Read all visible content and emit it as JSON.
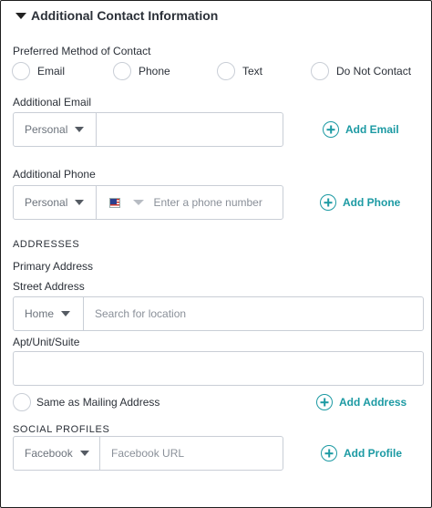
{
  "section": {
    "title": "Additional Contact Information"
  },
  "preferred_contact": {
    "label": "Preferred Method of Contact",
    "options": [
      "Email",
      "Phone",
      "Text",
      "Do Not Contact"
    ]
  },
  "additional_email": {
    "label": "Additional Email",
    "type_value": "Personal",
    "email_value": "",
    "email_placeholder": "",
    "add_label": "Add Email"
  },
  "additional_phone": {
    "label": "Additional Phone",
    "type_value": "Personal",
    "phone_placeholder": "Enter a phone number",
    "add_label": "Add Phone"
  },
  "addresses": {
    "heading": "ADDRESSES",
    "primary_label": "Primary Address",
    "street_label": "Street Address",
    "type_value": "Home",
    "search_placeholder": "Search for location",
    "apt_label": "Apt/Unit/Suite",
    "apt_value": "",
    "same_as_mailing_label": "Same as Mailing Address",
    "add_label": "Add Address"
  },
  "social": {
    "heading": "SOCIAL PROFILES",
    "type_value": "Facebook",
    "url_placeholder": "Facebook URL",
    "add_label": "Add Profile"
  },
  "colors": {
    "accent": "#1c9aa3",
    "border": "#c9ced6",
    "text": "#2b3038"
  },
  "icons": [
    "caret-down-icon",
    "dropdown-triangle-icon",
    "us-flag-icon",
    "plus-circle-icon"
  ]
}
